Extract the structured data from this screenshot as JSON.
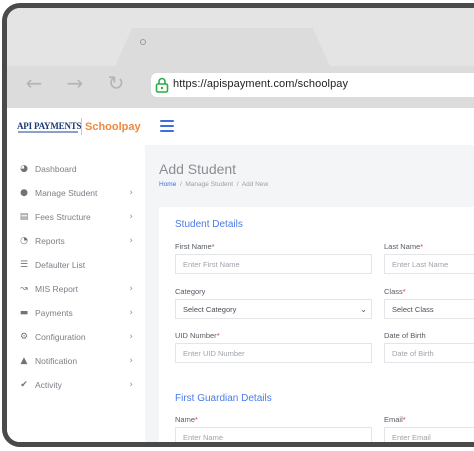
{
  "browser": {
    "url": "https://apispayment.com/schoolpay"
  },
  "brand": {
    "api_text": "API PAYMENTS",
    "app_name": "Schoolpay",
    "accent": "#3d6fe0",
    "brand_orange": "#f0883e"
  },
  "sidebar": {
    "items": [
      {
        "label": "Dashboard",
        "icon": "dashboard-icon",
        "has_chevron": false
      },
      {
        "label": "Manage Student",
        "icon": "user-icon",
        "has_chevron": true
      },
      {
        "label": "Fees Structure",
        "icon": "money-icon",
        "has_chevron": true
      },
      {
        "label": "Reports",
        "icon": "pie-chart-icon",
        "has_chevron": true
      },
      {
        "label": "Defaulter List",
        "icon": "list-icon",
        "has_chevron": false
      },
      {
        "label": "MIS Report",
        "icon": "line-chart-icon",
        "has_chevron": true
      },
      {
        "label": "Payments",
        "icon": "card-icon",
        "has_chevron": true
      },
      {
        "label": "Configuration",
        "icon": "gears-icon",
        "has_chevron": true
      },
      {
        "label": "Notification",
        "icon": "bell-icon",
        "has_chevron": true
      },
      {
        "label": "Activity",
        "icon": "check-circle-icon",
        "has_chevron": true
      }
    ]
  },
  "page": {
    "title": "Add Student",
    "breadcrumb": [
      "Home",
      "Manage Student",
      "Add New"
    ]
  },
  "form": {
    "student_section": "Student Details",
    "first_name": {
      "label": "First Name",
      "placeholder": "Enter First Name"
    },
    "last_name": {
      "label": "Last Name",
      "placeholder": "Enter Last Name"
    },
    "category": {
      "label": "Category",
      "value": "Select Category"
    },
    "class": {
      "label": "Class",
      "value": "Select Class"
    },
    "uid": {
      "label": "UID Number",
      "placeholder": "Enter UID Number"
    },
    "dob": {
      "label": "Date of Birth",
      "placeholder": "Date of Birth"
    },
    "guardian_section": "First Guardian Details",
    "guardian_name": {
      "label": "Name",
      "placeholder": "Enter Name"
    },
    "guardian_email": {
      "label": "Email",
      "placeholder": "Enter Email"
    }
  }
}
